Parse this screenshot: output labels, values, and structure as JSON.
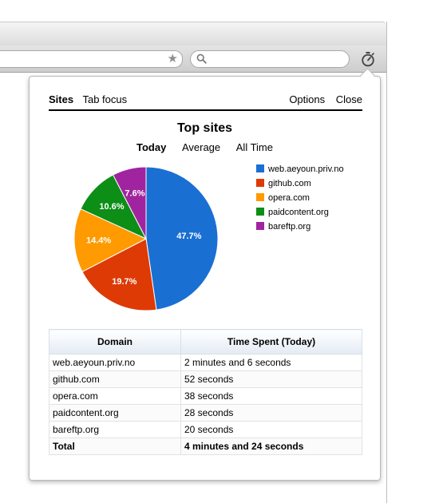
{
  "popup": {
    "nav": {
      "sites": "Sites",
      "tab_focus": "Tab focus",
      "options": "Options",
      "close": "Close"
    },
    "title": "Top sites",
    "periods": [
      "Today",
      "Average",
      "All Time"
    ],
    "active_period": "Today"
  },
  "chart_data": {
    "type": "pie",
    "title": "",
    "categories": [
      "web.aeyoun.priv.no",
      "github.com",
      "opera.com",
      "paidcontent.org",
      "bareftp.org"
    ],
    "values": [
      47.7,
      19.7,
      14.4,
      10.6,
      7.6
    ],
    "labels": [
      "47.7%",
      "19.7%",
      "14.4%",
      "10.6%",
      "7.6%"
    ],
    "colors": [
      "#1a6fd2",
      "#dd3a06",
      "#ff9a00",
      "#0d8e17",
      "#a0249f"
    ],
    "legend_position": "right"
  },
  "table": {
    "headers": [
      "Domain",
      "Time Spent (Today)"
    ],
    "rows": [
      [
        "web.aeyoun.priv.no",
        "2 minutes and 6 seconds"
      ],
      [
        "github.com",
        "52 seconds"
      ],
      [
        "opera.com",
        "38 seconds"
      ],
      [
        "paidcontent.org",
        "28 seconds"
      ],
      [
        "bareftp.org",
        "20 seconds"
      ]
    ],
    "total": [
      "Total",
      "4 minutes and 24 seconds"
    ]
  },
  "icons": {
    "bookmark": "star-icon",
    "search": "search-icon",
    "extension": "stopwatch-icon"
  }
}
